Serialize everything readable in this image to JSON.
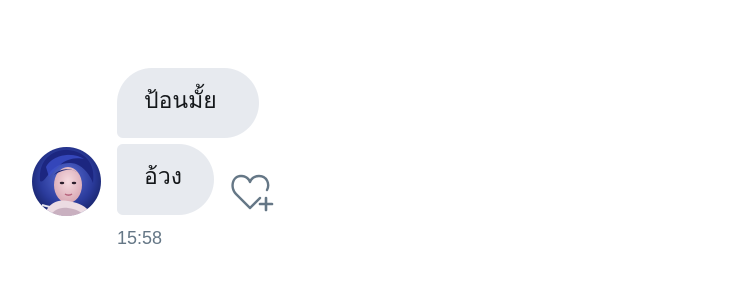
{
  "conversation": {
    "messages": [
      {
        "text": "ป้อนมั้ย"
      },
      {
        "text": "อ้วง"
      }
    ],
    "timestamp": "15:58",
    "sender_avatar": {
      "icon": "user-avatar-photo"
    },
    "like_action": {
      "icon": "heart-plus-icon"
    }
  },
  "colors": {
    "bubble_bg": "#e7eaef",
    "text": "#14171a",
    "meta_text": "#657786",
    "icon": "#657786"
  }
}
